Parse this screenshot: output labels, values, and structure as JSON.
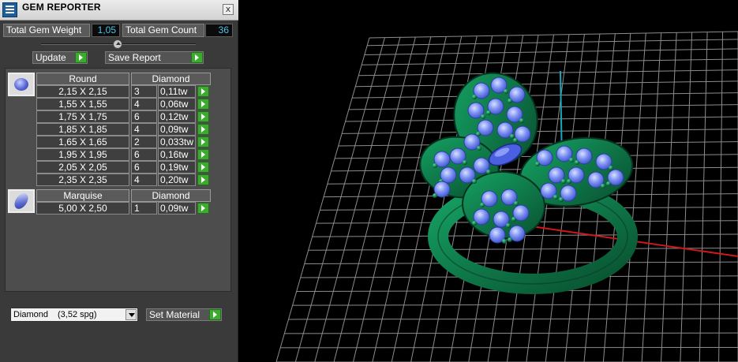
{
  "window": {
    "title": "GEM REPORTER",
    "close_label": "x"
  },
  "totals": {
    "weight_label": "Total Gem Weight",
    "weight_value": "1,05",
    "count_label": "Total Gem Count",
    "count_value": "36"
  },
  "actions": {
    "update_label": "Update",
    "save_report_label": "Save Report"
  },
  "gem_groups": [
    {
      "shape": "Round",
      "material": "Diamond",
      "icon": "round-gem-icon",
      "rows": [
        {
          "size": "2,15 X 2,15",
          "count": "3",
          "weight": "0,11tw"
        },
        {
          "size": "1,55 X 1,55",
          "count": "4",
          "weight": "0,06tw"
        },
        {
          "size": "1,75 X 1,75",
          "count": "6",
          "weight": "0,12tw"
        },
        {
          "size": "1,85 X 1,85",
          "count": "4",
          "weight": "0,09tw"
        },
        {
          "size": "1,65 X 1,65",
          "count": "2",
          "weight": "0,033tw"
        },
        {
          "size": "1,95 X 1,95",
          "count": "6",
          "weight": "0,16tw"
        },
        {
          "size": "2,05 X 2,05",
          "count": "6",
          "weight": "0,19tw"
        },
        {
          "size": "2,35 X 2,35",
          "count": "4",
          "weight": "0,20tw"
        }
      ]
    },
    {
      "shape": "Marquise",
      "material": "Diamond",
      "icon": "marquise-gem-icon",
      "rows": [
        {
          "size": "5,00 X 2,50",
          "count": "1",
          "weight": "0,09tw"
        }
      ]
    }
  ],
  "material_select": {
    "name": "Diamond",
    "gravity": "(3,52 spg)"
  },
  "set_material_label": "Set Material",
  "colors": {
    "panel_bg": "#3a3a3a",
    "value_text": "#4dc3e8",
    "go_button": "#3cab2e",
    "ring_metal": "#0e7a4a",
    "gem_blue": "#6f86f0",
    "grid_line": "#8c8c8c",
    "axis_red": "#d01818",
    "axis_cyan": "#19a7b8"
  }
}
